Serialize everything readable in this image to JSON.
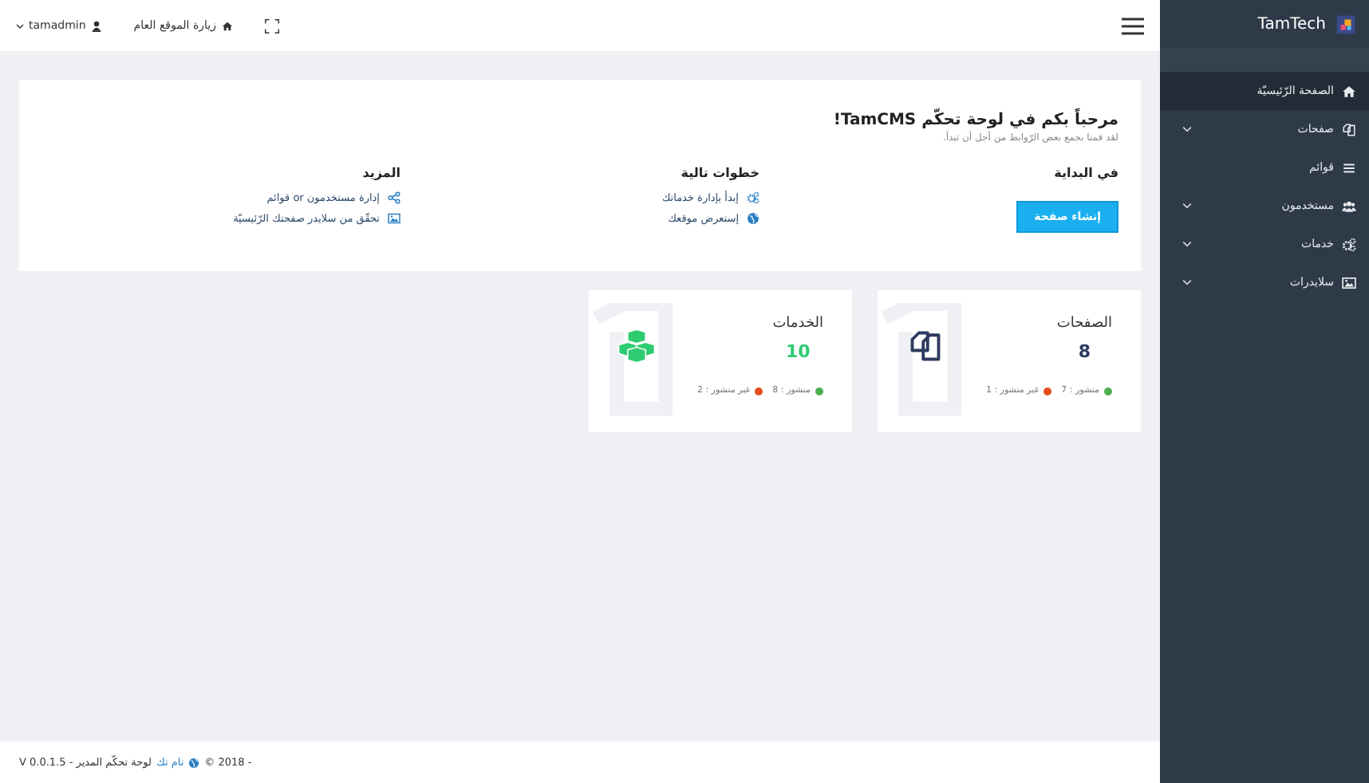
{
  "sidebar": {
    "brand": "TamTech",
    "items": [
      {
        "label": "الصفحة الرّئيسيّة",
        "selected": true,
        "expandable": false
      },
      {
        "label": "صفحات",
        "selected": false,
        "expandable": true
      },
      {
        "label": "قوائم",
        "selected": false,
        "expandable": false
      },
      {
        "label": "مستخدمون",
        "selected": false,
        "expandable": true
      },
      {
        "label": "خدمات",
        "selected": false,
        "expandable": true
      },
      {
        "label": "سلايدرات",
        "selected": false,
        "expandable": true
      }
    ]
  },
  "topbar": {
    "user": "tamadmin",
    "visit_link": "زيارة الموقع العام"
  },
  "welcome": {
    "title": "مرحباً بكم في لوحة تحكّم TamCMS!",
    "subtitle": "لقد قمنا بجمع بعض الرّوابط من أجل أن تبدأ.",
    "columns": [
      {
        "heading": "في البداية",
        "kind": "button",
        "button": "إنشاء صفحة"
      },
      {
        "heading": "خطوات تالية",
        "kind": "links",
        "links": [
          {
            "text": "إبدأ بإدارة خدماتك"
          },
          {
            "text": "إستعرض موقعك"
          }
        ]
      },
      {
        "heading": "المزيد",
        "kind": "links",
        "links": [
          {
            "text": "إدارة مستخدمون or قوائم"
          },
          {
            "text": "تحقّق من سلايدر صفحتك الرّئيسيّة"
          }
        ]
      }
    ]
  },
  "stats": [
    {
      "title": "الصفحات",
      "count": "8",
      "color": "#2c3a5f",
      "published": "منشور : 7",
      "unpublished": "غير منشور : 1"
    },
    {
      "title": "الخدمات",
      "count": "10",
      "color": "#2ecc71",
      "published": "منشور : 8",
      "unpublished": "غير منشور : 2"
    }
  ],
  "footer": {
    "copyright": "© 2018 -",
    "link": "تام تك",
    "rest": "لوحة تحكّم المدير - V 0.0.1.5"
  }
}
